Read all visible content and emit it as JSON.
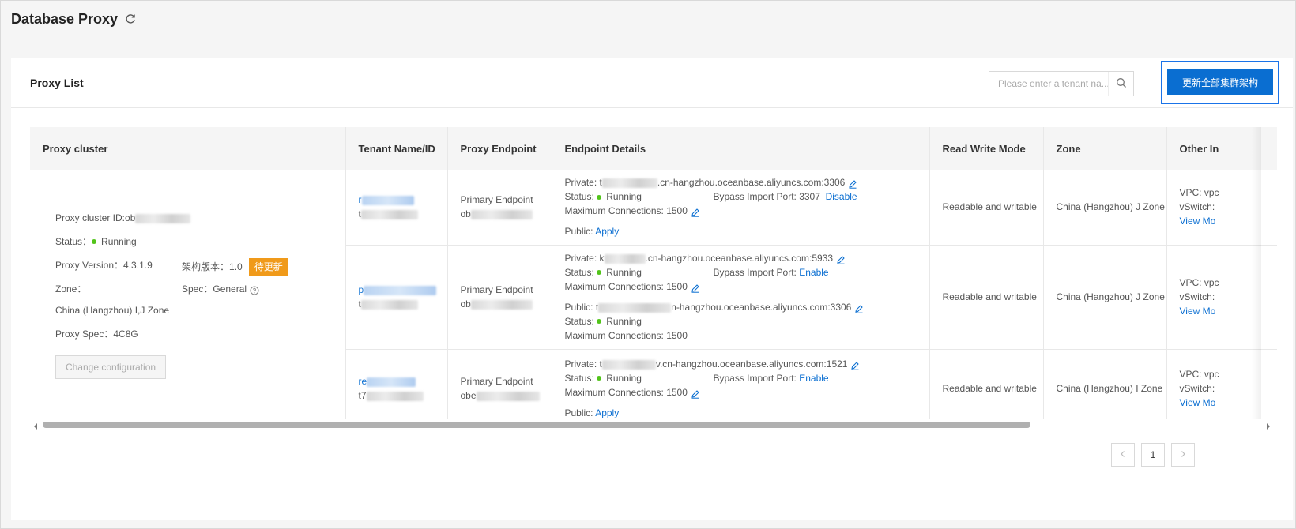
{
  "header": {
    "title": "Database Proxy",
    "refresh_icon": "refresh-icon"
  },
  "panel": {
    "title": "Proxy List",
    "search": {
      "placeholder": "Please enter a tenant na...",
      "value": ""
    },
    "primary_button": "更新全部集群架构"
  },
  "table": {
    "columns": [
      "Proxy cluster",
      "Tenant Name/ID",
      "Proxy Endpoint",
      "Endpoint Details",
      "Read Write Mode",
      "Zone",
      "Other In"
    ],
    "cluster": {
      "id_label": "Proxy cluster ID:ob",
      "status_label": "Status：",
      "status_value": "Running",
      "version_label": "Proxy Version：",
      "version_value": "4.3.1.9",
      "arch_label": "架构版本：",
      "arch_value": "1.0",
      "arch_badge": "待更新",
      "zone_label": "Zone：",
      "zone_value": "China (Hangzhou) I,J Zone",
      "spec_label": "Spec：",
      "spec_value": "General",
      "proxy_spec_label": "Proxy Spec：",
      "proxy_spec_value": "4C8G",
      "change_button": "Change configuration"
    },
    "rows": [
      {
        "tenant_prefix": "r",
        "tenant_id_prefix": "t",
        "endpoint_type": "Primary Endpoint",
        "endpoint_prefix": "ob",
        "private_prefix": "Private: t",
        "private_suffix": ".cn-hangzhou.oceanbase.aliyuncs.com:3306",
        "status_label": "Status:",
        "status_value": "Running",
        "bypass_label": "Bypass Import Port: 3307",
        "bypass_action": "Disable",
        "max_conn": "Maximum Connections: 1500",
        "public_label": "Public:",
        "public_action": "Apply",
        "mode": "Readable and writable",
        "zone": "China (Hangzhou) J Zone",
        "vpc": "VPC: vpc",
        "vswitch": "vSwitch:",
        "view_more": "View Mo"
      },
      {
        "tenant_prefix": "p",
        "tenant_id_prefix": "t",
        "endpoint_type": "Primary Endpoint",
        "endpoint_prefix": "ob",
        "private_prefix": "Private: k",
        "private_suffix": ".cn-hangzhou.oceanbase.aliyuncs.com:5933",
        "status_label": "Status:",
        "status_value": "Running",
        "bypass_label": "Bypass Import Port:",
        "bypass_action": "Enable",
        "max_conn": "Maximum Connections: 1500",
        "public_prefix": "Public: t",
        "public_suffix": "n-hangzhou.oceanbase.aliyuncs.com:3306",
        "public_status_label": "Status:",
        "public_status_value": "Running",
        "public_max_conn": "Maximum Connections: 1500",
        "mode": "Readable and writable",
        "zone": "China (Hangzhou) J Zone",
        "vpc": "VPC: vpc",
        "vswitch": "vSwitch:",
        "view_more": "View Mo"
      },
      {
        "tenant_prefix": "re",
        "tenant_id_prefix": "t7",
        "endpoint_type": "Primary Endpoint",
        "endpoint_prefix": "obe",
        "private_prefix": "Private: t",
        "private_suffix": "v.cn-hangzhou.oceanbase.aliyuncs.com:1521",
        "status_label": "Status:",
        "status_value": "Running",
        "bypass_label": "Bypass Import Port:",
        "bypass_action": "Enable",
        "max_conn": "Maximum Connections: 1500",
        "public_label": "Public:",
        "public_action": "Apply",
        "mode": "Readable and writable",
        "zone": "China (Hangzhou) I Zone",
        "vpc": "VPC: vpc",
        "vswitch": "vSwitch:",
        "view_more": "View Mo"
      }
    ]
  },
  "pagination": {
    "current_page": "1"
  },
  "colors": {
    "accent": "#0a6ed1",
    "running": "#52c41a",
    "badge": "#f09a1a"
  }
}
